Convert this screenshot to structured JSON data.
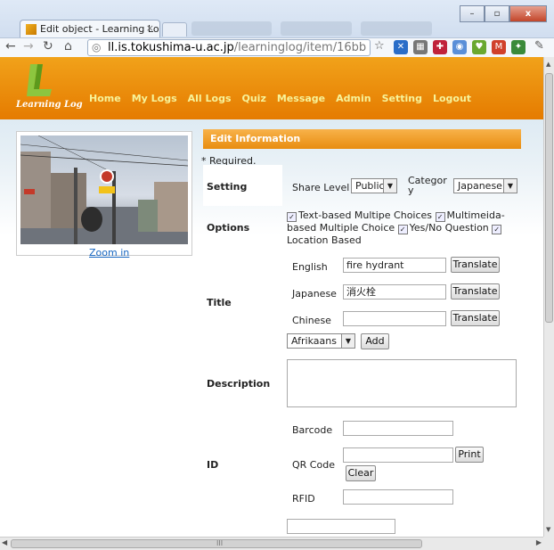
{
  "browser": {
    "tab_title": "Edit object - Learning Lo",
    "tab_close": "×",
    "url_host": "ll.is.tokushima-u.ac.jp",
    "url_path": "/learninglog/item/16bb",
    "window_minimize": "–",
    "window_maximize": "▫",
    "window_close": "x",
    "icons": [
      "back-icon",
      "forward-icon",
      "reload-icon",
      "home-icon",
      "globe-icon",
      "star-icon",
      "extension-icon",
      "wrench-icon"
    ]
  },
  "site": {
    "logo_text": "Learning Log",
    "nav": [
      "Home",
      "My Logs",
      "All Logs",
      "Quiz",
      "Message",
      "Admin",
      "Setting",
      "Logout"
    ],
    "zoom_label": "Zoom in"
  },
  "form": {
    "section_title": "Edit Information",
    "required_note": "* Required.",
    "setting": {
      "label": "Setting",
      "share_level_label": "Share Level",
      "share_level_value": "Public",
      "category_label": "Categor y",
      "category_value": "Japanese"
    },
    "options": {
      "label": "Options",
      "items": [
        "Text-based Multipe Choices",
        "Multimeida-based Multiple Choice",
        "Yes/No Question",
        "Location Based"
      ]
    },
    "title": {
      "label": "Title",
      "fields": [
        {
          "label": "English",
          "value": "fire hydrant",
          "button": "Translate"
        },
        {
          "label": "Japanese",
          "value": "消火栓",
          "button": "Translate"
        },
        {
          "label": "Chinese",
          "value": "",
          "button": "Translate"
        }
      ],
      "language_select": "Afrikaans",
      "add_button": "Add"
    },
    "description": {
      "label": "Description",
      "value": ""
    },
    "id": {
      "label": "ID",
      "barcode_label": "Barcode",
      "barcode_value": "",
      "qrcode_label": "QR Code",
      "qrcode_value": "",
      "print_button": "Print",
      "clear_button": "Clear",
      "rfid_label": "RFID",
      "rfid_value": ""
    }
  },
  "scrollbar": {
    "horizontal_grip": "III"
  },
  "colors": {
    "header_orange": "#e57b00",
    "nav_text": "#f7f39a",
    "link_blue": "#1565c0"
  }
}
